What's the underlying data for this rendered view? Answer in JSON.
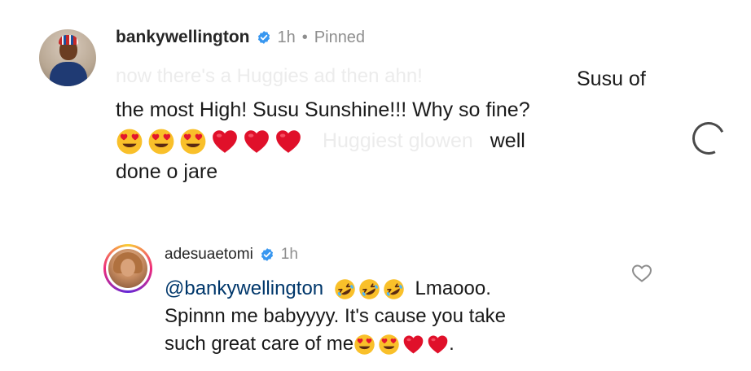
{
  "comment": {
    "username": "bankywellington",
    "time": "1h",
    "separator": "•",
    "pinned_label": "Pinned",
    "faded_line": "now there's a Huggies ad then ahn!",
    "line1_tail": "Susu of",
    "line2": "the most High! Susu Sunshine!!! Why so fine?",
    "line3_faded": "Huggiest glowen",
    "line3_tail": "well",
    "line4": "done o jare",
    "emojis": [
      "heart-eyes",
      "heart-eyes",
      "heart-eyes",
      "red-heart",
      "red-heart",
      "red-heart"
    ]
  },
  "reply": {
    "username": "adesuaetomi",
    "time": "1h",
    "mention": "@bankywellington",
    "line1_tail": "Lmaooo.",
    "line2": "Spinnn me babyyyy. It's cause you take",
    "line3": "such great care of me",
    "line3_end": ".",
    "emojis_line1": [
      "rolling-laughing",
      "rolling-laughing",
      "rolling-laughing"
    ],
    "emojis_line3": [
      "heart-eyes",
      "heart-eyes",
      "red-heart",
      "red-heart"
    ]
  },
  "colors": {
    "verified": "#3897f0",
    "mention": "#00376b",
    "meta": "#8e8e8e",
    "heart": "#e0102a",
    "emoji_face": "#f9c02a"
  }
}
